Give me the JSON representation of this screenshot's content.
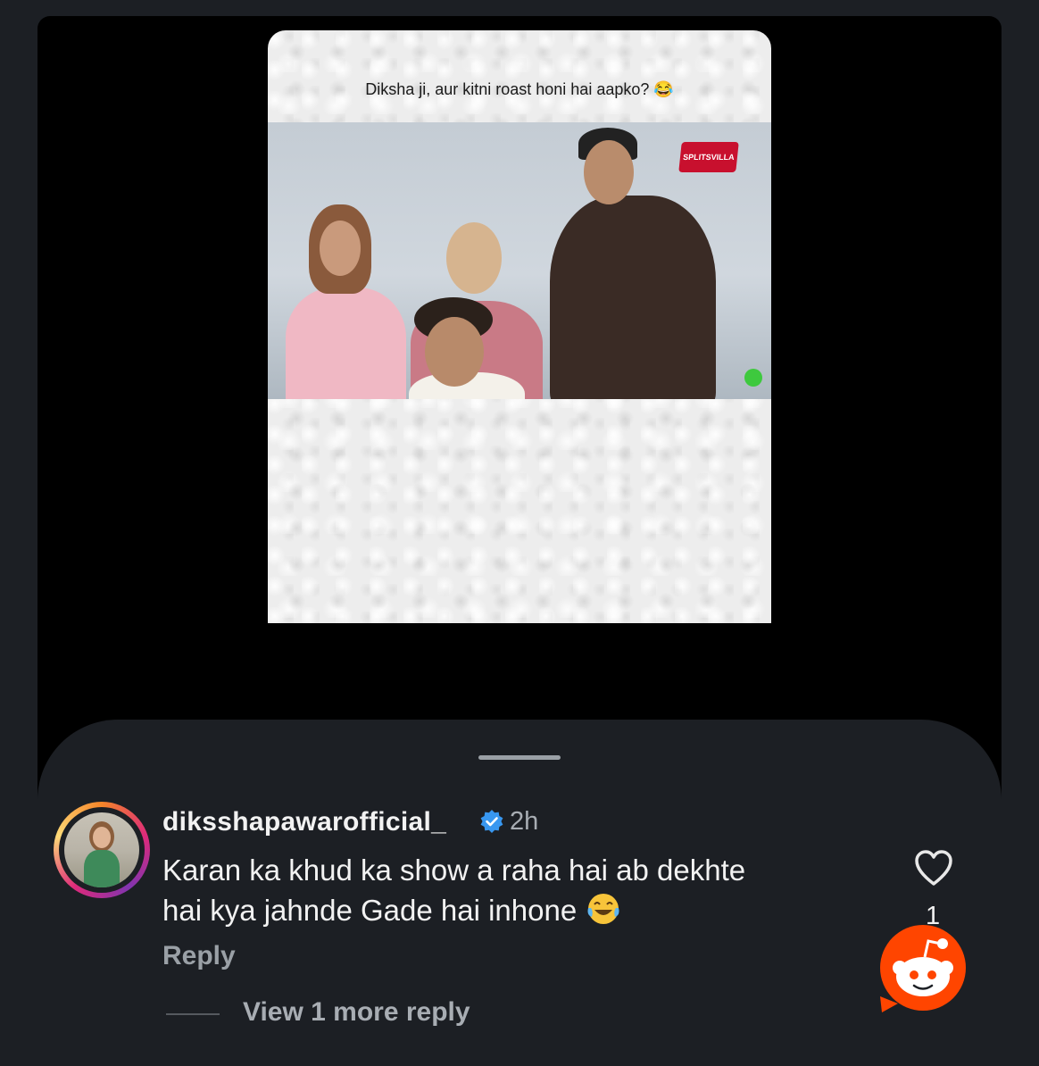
{
  "post": {
    "caption": "Diksha ji, aur kitni roast honi hai aapko? 😂",
    "show_logo_text": "SPLITSVILLA"
  },
  "comment": {
    "username": "diksshapawarofficial_",
    "time": "2h",
    "text_line1": "Karan ka khud ka show a raha hai ab dekhte",
    "text_line2": "hai kya jahnde Gade hai inhone",
    "reply_label": "Reply",
    "view_more_label": "View 1 more reply",
    "like_count": "1"
  },
  "colors": {
    "background": "#1c1f24",
    "panel": "#000000",
    "verified": "#3897f0",
    "reddit": "#ff4500"
  }
}
